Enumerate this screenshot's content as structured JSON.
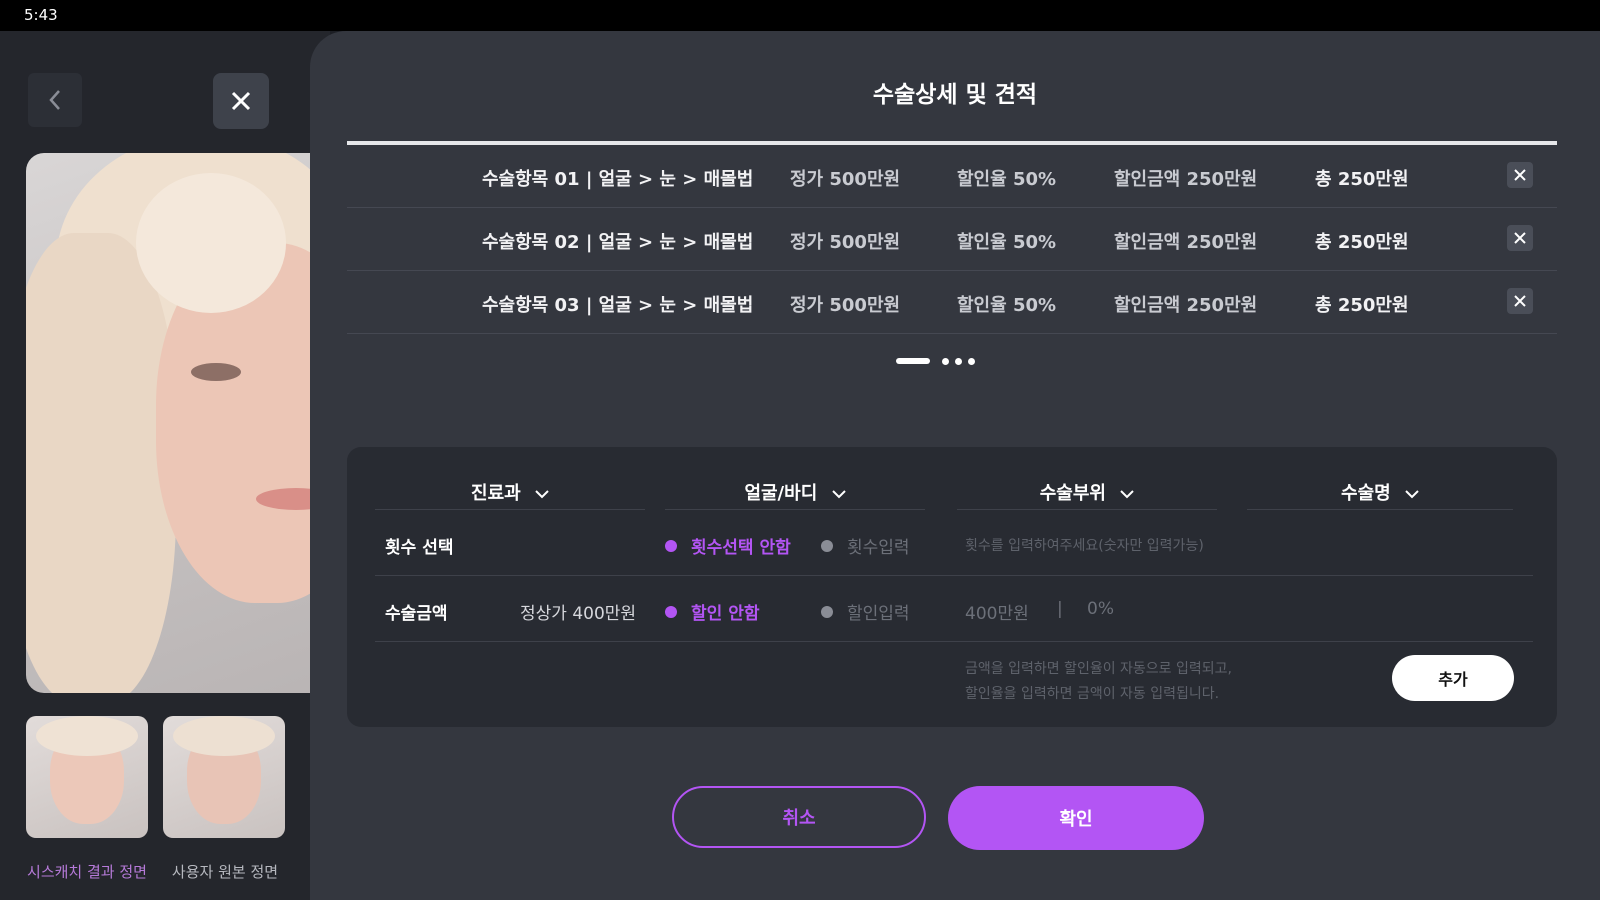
{
  "status_bar": {
    "time": "5:43"
  },
  "left_panel": {
    "back_icon": "chevron-left-icon",
    "close_icon": "close-icon",
    "thumbnails": [
      {
        "label": "시스캐치 결과 정면",
        "selected": true
      },
      {
        "label": "사용자 원본 정면",
        "selected": false
      }
    ]
  },
  "modal": {
    "title": "수술상세 및 견적",
    "items": [
      {
        "name": "수술항목 01 | 얼굴 > 눈 > 매몰법",
        "price": "정가 500만원",
        "rate": "할인율 50%",
        "discount": "할인금액 250만원",
        "total": "총 250만원"
      },
      {
        "name": "수술항목 02 | 얼굴 > 눈 > 매몰법",
        "price": "정가 500만원",
        "rate": "할인율 50%",
        "discount": "할인금액 250만원",
        "total": "총 250만원"
      },
      {
        "name": "수술항목 03 | 얼굴 > 눈 > 매몰법",
        "price": "정가 500만원",
        "rate": "할인율 50%",
        "discount": "할인금액 250만원",
        "total": "총 250만원"
      }
    ],
    "form": {
      "selects": [
        {
          "label": "진료과"
        },
        {
          "label": "얼굴/바디"
        },
        {
          "label": "수술부위"
        },
        {
          "label": "수술명"
        }
      ],
      "count_row": {
        "title": "횟수 선택",
        "option_on": "횟수선택 안함",
        "option_off": "횟수입력",
        "placeholder": "횟수를 입력하여주세요(숫자만 입력가능)"
      },
      "amount_row": {
        "title": "수술금액",
        "regular_price": "정상가 400만원",
        "option_on": "할인 안함",
        "option_off": "할인입력",
        "amount": "400만원",
        "separator": "|",
        "rate": "0%"
      },
      "help_lines": [
        "금액을 입력하면 할인율이 자동으로 입력되고,",
        "할인율을 입력하면 금액이 자동 입력됩니다."
      ],
      "add_label": "추가"
    },
    "cancel_label": "취소",
    "confirm_label": "확인",
    "colors": {
      "accent": "#b355f4",
      "panel": "#34373f",
      "card": "#282b32"
    }
  }
}
